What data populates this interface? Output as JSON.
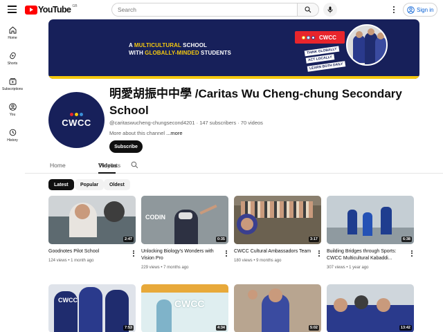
{
  "header": {
    "logo_text": "YouTube",
    "region": "GB",
    "search_placeholder": "Search",
    "signin_label": "Sign in"
  },
  "sidebar": {
    "items": [
      {
        "label": "Home",
        "icon": "home-icon"
      },
      {
        "label": "Shorts",
        "icon": "shorts-icon"
      },
      {
        "label": "Subscriptions",
        "icon": "subscriptions-icon"
      },
      {
        "label": "You",
        "icon": "you-icon"
      },
      {
        "label": "History",
        "icon": "history-icon"
      }
    ]
  },
  "banner": {
    "line1_pre": "A ",
    "line1_highlight": "MULTICULTURAL",
    "line1_post": " SCHOOL",
    "line2_pre": "WITH ",
    "line2_highlight": "GLOBALLY-MINDED",
    "line2_post": " STUDENTS",
    "badge": "CWCC",
    "tags": [
      "THINK GLOBALLY",
      "ACT LOCALLY",
      "LEARN BOTH DAILY"
    ]
  },
  "channel": {
    "title": "明愛胡振中中學 /Caritas Wu Cheng-chung Secondary School",
    "meta": "@caritaswucheng-chungsecond4201 · 147 subscribers · 70 videos",
    "about": "More about this channel",
    "about_more": "...more",
    "subscribe_label": "Subscribe",
    "avatar_text": "CWCC"
  },
  "tabs": [
    "Home",
    "Videos",
    "Playlists"
  ],
  "active_tab": "Videos",
  "filters": [
    "Latest",
    "Popular",
    "Oldest"
  ],
  "active_filter": "Latest",
  "videos": [
    {
      "title": "Goodnotes Pilot School",
      "meta": "124 views • 1 month ago",
      "duration": "2:47"
    },
    {
      "title": "Unlocking Biology's Wonders with Vision Pro",
      "meta": "229 views • 7 months ago",
      "duration": "0:35"
    },
    {
      "title": "CWCC Cultural Ambassadors Team",
      "meta": "180 views • 9 months ago",
      "duration": "3:17"
    },
    {
      "title": "Building Bridges through Sports: CWCC Multicultural Kabaddi...",
      "meta": "307 views • 1 year ago",
      "duration": "6:38"
    },
    {
      "title": "",
      "meta": "",
      "duration": "7:53"
    },
    {
      "title": "",
      "meta": "",
      "duration": "4:34"
    },
    {
      "title": "",
      "meta": "",
      "duration": "5:02"
    },
    {
      "title": "",
      "meta": "",
      "duration": "13:42"
    }
  ],
  "colors": {
    "youtube_red": "#ff0000",
    "brand_navy": "#17205a",
    "brand_yellow": "#f6c90e",
    "link_blue": "#065fd4"
  }
}
